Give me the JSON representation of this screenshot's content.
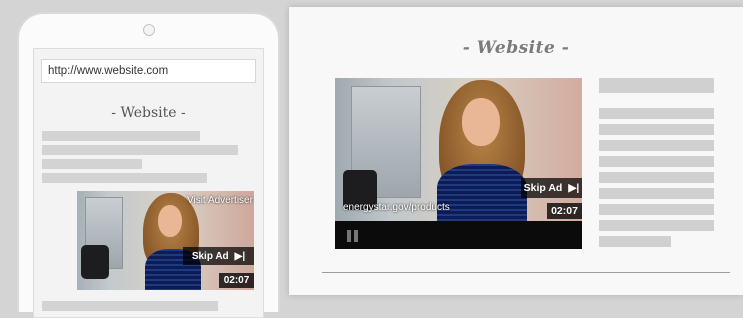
{
  "phone": {
    "address_bar": "http://www.website.com",
    "page_title": "- Website -",
    "video": {
      "visit_label": "Visit Advertiser",
      "skip_label": "Skip Ad",
      "skip_icon": "skip-next-icon",
      "time": "02:07"
    }
  },
  "desktop": {
    "page_title": "- Website -",
    "video": {
      "url_overlay": "energystar.gov/products",
      "skip_label": "Skip Ad",
      "skip_icon": "skip-next-icon",
      "time": "02:07",
      "control_icon": "pause-icon"
    }
  },
  "colors": {
    "placeholder_bar": "#d3d3d3",
    "overlay_bg": "#000000",
    "controls_bg": "#0b0b0b"
  }
}
